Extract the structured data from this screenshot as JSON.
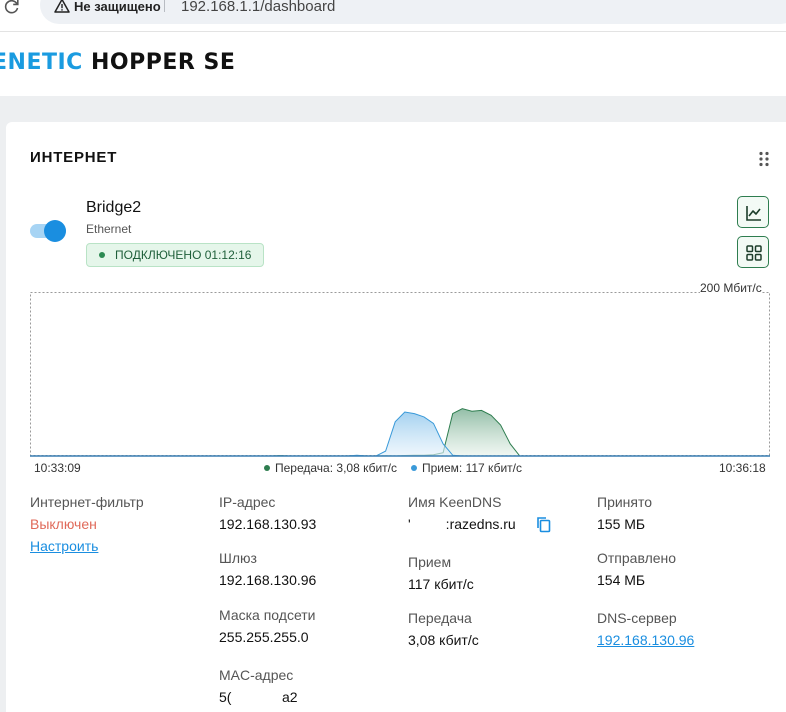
{
  "browser": {
    "security_label": "Не защищено",
    "url": "192.168.1.1/dashboard"
  },
  "brand": {
    "part1": "ENETIC",
    "part2": "HOPPER SE"
  },
  "card": {
    "title": "ИНТЕРНЕТ"
  },
  "connection": {
    "enabled": true,
    "name": "Bridge2",
    "type": "Ethernet",
    "status": "ПОДКЛЮЧЕНО 01:12:16"
  },
  "chart_data": {
    "type": "area",
    "ymax_label": "200 Мбит/с",
    "ylim": [
      0,
      200
    ],
    "x_start": "10:33:09",
    "x_end": "10:36:18",
    "series": [
      {
        "name": "Передача: 3,08 кбит/с",
        "color": "#2e7d4f",
        "values": [
          0,
          0,
          0,
          0,
          0,
          0,
          0,
          0,
          0,
          0,
          0,
          0,
          0,
          0,
          0,
          0,
          0,
          0,
          0,
          0,
          0,
          0,
          0,
          0,
          0,
          0,
          0.5,
          0,
          0,
          0,
          0,
          0,
          0,
          0,
          0.4,
          0,
          0,
          0.5,
          0,
          0.6,
          1,
          1,
          1.5,
          4,
          52,
          58,
          55,
          56,
          50,
          38,
          15,
          0,
          0,
          0,
          0,
          0,
          0,
          0,
          0,
          0,
          0,
          0,
          0,
          0,
          0,
          0,
          0,
          0,
          0,
          0,
          0,
          0,
          0,
          0,
          0,
          0,
          0,
          0
        ]
      },
      {
        "name": "Прием: 117 кбит/с",
        "color": "#3a9ad9",
        "values": [
          0,
          0,
          0,
          0,
          0,
          0,
          0,
          0,
          0,
          0,
          0,
          0,
          0,
          0,
          0,
          0,
          0,
          0,
          0,
          0,
          0,
          0,
          0,
          0,
          0,
          0,
          0,
          0,
          0,
          0,
          0,
          0,
          0,
          0,
          1,
          0,
          0,
          6,
          42,
          54,
          52,
          48,
          40,
          15,
          1,
          0,
          0,
          0,
          0,
          0,
          0,
          0,
          0,
          0,
          0,
          0,
          0,
          0,
          0,
          0,
          0,
          0,
          0,
          0,
          0,
          0,
          0,
          0,
          0,
          0,
          0,
          0,
          0,
          0,
          0,
          0,
          0,
          0
        ]
      }
    ],
    "legend": {
      "tx_label": "Передача: 3,08 кбит/с",
      "rx_label": "Прием: 117 кбит/с"
    }
  },
  "info": {
    "filter": {
      "label": "Интернет-фильтр",
      "value": "Выключен",
      "link": "Настроить"
    },
    "ip": {
      "label": "IP-адрес",
      "value": "192.168.130.93"
    },
    "gateway": {
      "label": "Шлюз",
      "value": "192.168.130.96"
    },
    "mask": {
      "label": "Маска подсети",
      "value": "255.255.255.0"
    },
    "mac": {
      "label": "MAC-адрес",
      "value": "5(             a2"
    },
    "keendns": {
      "label": "Имя KeenDNS",
      "value": "'         :razedns.ru"
    },
    "rx_rate": {
      "label": "Прием",
      "value": "117 кбит/с"
    },
    "tx_rate": {
      "label": "Передача",
      "value": "3,08 кбит/с"
    },
    "received": {
      "label": "Принято",
      "value": "155 МБ"
    },
    "sent": {
      "label": "Отправлено",
      "value": "154 МБ"
    },
    "dns": {
      "label": "DNS-сервер",
      "value": "192.168.130.96"
    }
  }
}
